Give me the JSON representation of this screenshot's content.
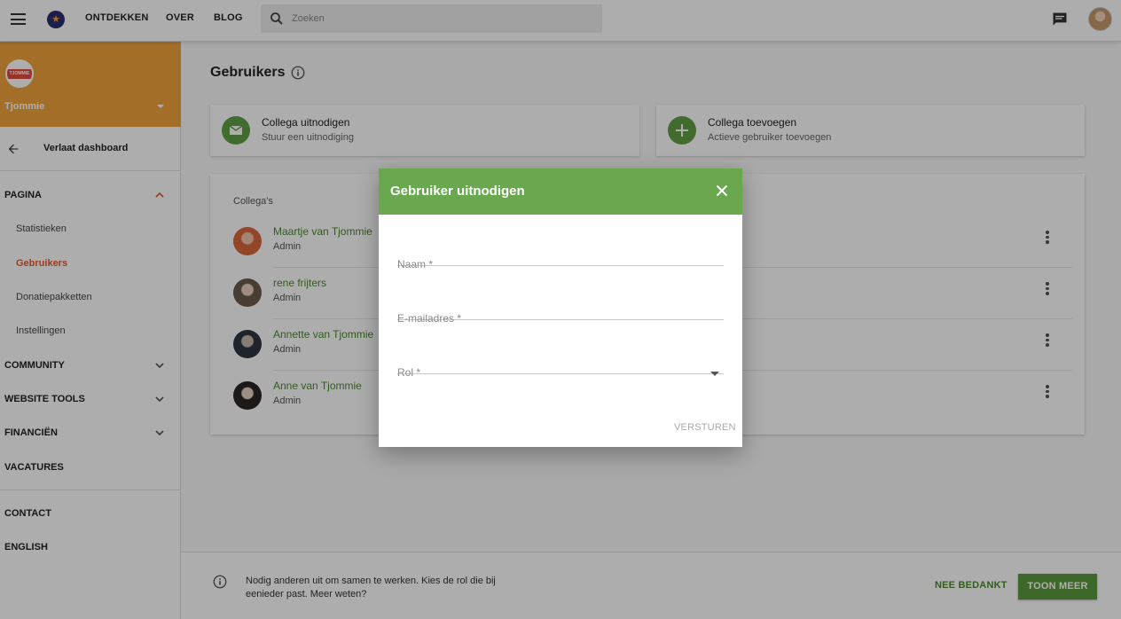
{
  "topbar": {
    "nav": [
      "ONTDEKKEN",
      "OVER",
      "BLOG"
    ],
    "search_placeholder": "Zoeken"
  },
  "sidebar": {
    "org_name": "Tjommie",
    "org_logo_text": "TJOMMIE",
    "leave_label": "Verlaat dashboard",
    "sections": {
      "pagina": "PAGINA",
      "community": "COMMUNITY",
      "website_tools": "WEBSITE TOOLS",
      "financien": "FINANCIËN",
      "vacatures": "VACATURES",
      "contact": "CONTACT",
      "english": "ENGLISH"
    },
    "pagina_items": [
      "Statistieken",
      "Gebruikers",
      "Donatiepakketten",
      "Instellingen"
    ]
  },
  "main": {
    "title": "Gebruikers",
    "invite_card": {
      "title": "Collega uitnodigen",
      "subtitle": "Stuur een uitnodiging"
    },
    "add_card": {
      "title": "Collega toevoegen",
      "subtitle": "Actieve gebruiker toevoegen"
    },
    "list_heading": "Collega's",
    "members": [
      {
        "name": "Maartje van Tjommie",
        "role": "Admin"
      },
      {
        "name": "rene frijters",
        "role": "Admin"
      },
      {
        "name": "Annette van Tjommie",
        "role": "Admin"
      },
      {
        "name": "Anne van Tjommie",
        "role": "Admin"
      }
    ]
  },
  "bottombar": {
    "message": "Nodig anderen uit om samen te werken. Kies de rol die bij eenieder past. Meer weten?",
    "dismiss": "NEE BEDANKT",
    "more": "TOON MEER"
  },
  "dialog": {
    "title": "Gebruiker uitnodigen",
    "fields": {
      "name": "Naam *",
      "email": "E-mailadres *",
      "role": "Rol *"
    },
    "send": "VERSTUREN"
  },
  "colors": {
    "accent_green": "#6aa84f",
    "org_orange": "#f0a43b",
    "active_red": "#e4572e"
  }
}
